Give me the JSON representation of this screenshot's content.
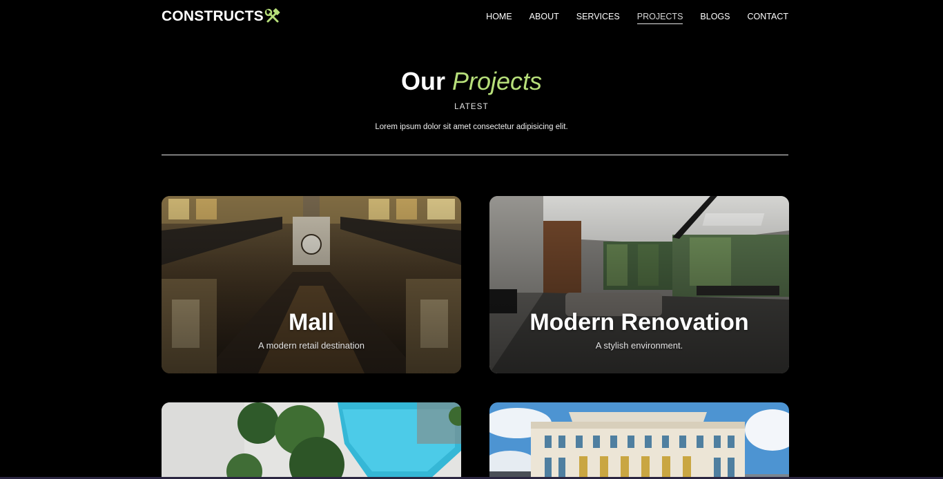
{
  "brand": {
    "name": "CONSTRUCTS",
    "icon": "crossed-hammer-wrench-icon",
    "icon_color": "#b7df7a"
  },
  "nav": {
    "items": [
      {
        "label": "HOME"
      },
      {
        "label": "ABOUT"
      },
      {
        "label": "SERVICES"
      },
      {
        "label": "PROJECTS",
        "active": true
      },
      {
        "label": "BLOGS"
      },
      {
        "label": "CONTACT"
      }
    ]
  },
  "hero": {
    "title_strong": "Our",
    "title_accent": "Projects",
    "kicker": "LATEST",
    "description": "Lorem ipsum dolor sit amet consectetur adipisicing elit."
  },
  "projects": [
    {
      "title": "Mall",
      "subtitle": "A modern retail destination"
    },
    {
      "title": "Modern Renovation",
      "subtitle": "A stylish environment."
    },
    {
      "title": "",
      "subtitle": ""
    },
    {
      "title": "",
      "subtitle": ""
    }
  ],
  "colors": {
    "background": "#000000",
    "accent": "#b7df7a",
    "text": "#ffffff",
    "divider": "#e9e9e9"
  }
}
